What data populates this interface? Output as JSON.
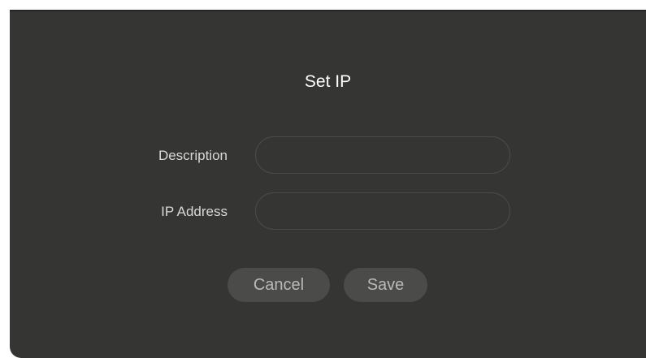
{
  "dialog": {
    "title": "Set IP",
    "fields": [
      {
        "label": "Description",
        "value": "",
        "placeholder": ""
      },
      {
        "label": "IP Address",
        "value": "",
        "placeholder": ""
      }
    ],
    "buttons": {
      "cancel": "Cancel",
      "save": "Save"
    }
  },
  "colors": {
    "dialog_background": "#353634",
    "input_border": "#4a4b4a",
    "button_background": "#4b4c4a",
    "button_text": "#b9b9b9",
    "title_text": "#ffffff",
    "label_text": "#d8d8d8"
  }
}
